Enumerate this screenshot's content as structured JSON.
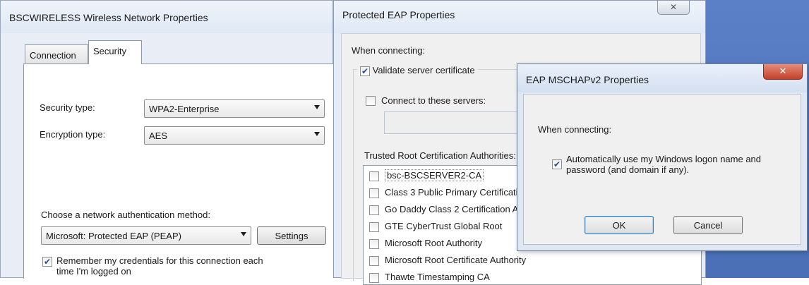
{
  "window1": {
    "title": "BSCWIRELESS Wireless Network Properties",
    "tabs": [
      "Connection",
      "Security"
    ],
    "security_type_label": "Security type:",
    "security_type_value": "WPA2-Enterprise",
    "encryption_type_label": "Encryption type:",
    "encryption_type_value": "AES",
    "auth_method_label": "Choose a network authentication method:",
    "auth_method_value": "Microsoft: Protected EAP (PEAP)",
    "settings_button": "Settings",
    "remember_creds_line1": "Remember my credentials for this connection each",
    "remember_creds_line2": "time I'm logged on",
    "remember_creds_checked": true
  },
  "window2": {
    "title": "Protected EAP Properties",
    "close_glyph": "✕",
    "when_connecting_label": "When connecting:",
    "validate_cert_label": "Validate server certificate",
    "validate_cert_checked": true,
    "connect_servers_label": "Connect to these servers:",
    "connect_servers_checked": false,
    "trusted_root_label": "Trusted Root Certification Authorities:",
    "cas": [
      "bsc-BSCSERVER2-CA",
      "Class 3 Public Primary Certification Authority",
      "Go Daddy Class 2 Certification Authority",
      "GTE CyberTrust Global Root",
      "Microsoft Root Authority",
      "Microsoft Root Certificate Authority",
      "Thawte Timestamping CA"
    ]
  },
  "window3": {
    "title": "EAP MSCHAPv2 Properties",
    "close_glyph": "✕",
    "when_connecting_label": "When connecting:",
    "auto_logon_line1": "Automatically use my Windows logon name and",
    "auto_logon_line2": "password (and domain if any).",
    "auto_logon_checked": true,
    "ok_button": "OK",
    "cancel_button": "Cancel"
  },
  "colors": {
    "desktop": "#4a6fb6",
    "close_red": "#c2412a",
    "window_frame": "#dfe7f3"
  }
}
